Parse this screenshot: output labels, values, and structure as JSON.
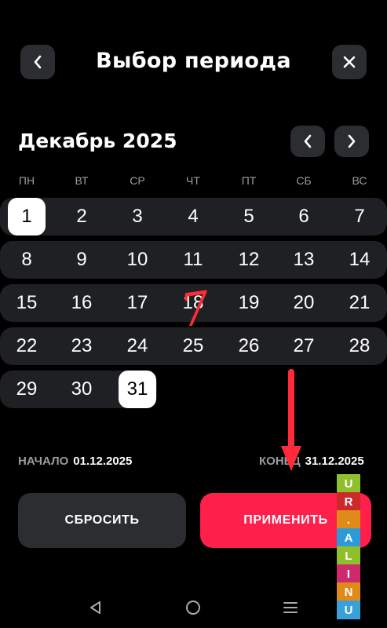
{
  "header": {
    "title": "Выбор периода",
    "back_icon": "chevron-left-icon",
    "close_icon": "close-icon"
  },
  "calendar": {
    "month_label": "Декабрь 2025",
    "weekdays": [
      "ПН",
      "ВТ",
      "СР",
      "ЧТ",
      "ПТ",
      "СБ",
      "ВС"
    ],
    "weeks": [
      [
        "1",
        "2",
        "3",
        "4",
        "5",
        "6",
        "7"
      ],
      [
        "8",
        "9",
        "10",
        "11",
        "12",
        "13",
        "14"
      ],
      [
        "15",
        "16",
        "17",
        "18",
        "19",
        "20",
        "21"
      ],
      [
        "22",
        "23",
        "24",
        "25",
        "26",
        "27",
        "28"
      ],
      [
        "29",
        "30",
        "31"
      ]
    ],
    "selected_start": "1",
    "selected_end": "31"
  },
  "range": {
    "start_label": "НАЧАЛО",
    "start_value": "01.12.2025",
    "end_label": "КОНЕЦ",
    "end_value": "31.12.2025"
  },
  "actions": {
    "reset_label": "СБРОСИТЬ",
    "apply_label": "ПРИМЕНИТЬ",
    "apply_color": "#ff1f4b"
  },
  "overlay": {
    "handwritten_number": "7",
    "arrow_color": "#ff2a3a"
  },
  "watermark": {
    "letters": [
      "U",
      "N",
      "I",
      "L",
      "A",
      ".",
      "R",
      "U"
    ],
    "colors": [
      "#3aa0d8",
      "#e08a1a",
      "#cc2a6a",
      "#8fbf2a",
      "#2a9ad8",
      "#cc2a2a",
      "#e08a1a",
      "#8fbf2a"
    ]
  },
  "system_nav": [
    "back-icon",
    "home-icon",
    "recents-icon"
  ]
}
